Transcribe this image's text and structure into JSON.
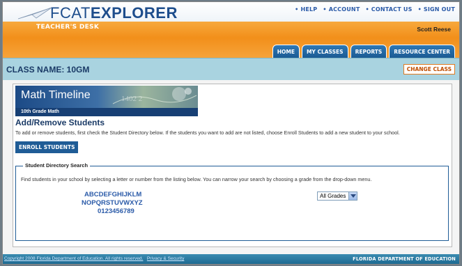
{
  "brand": {
    "logo_prefix": "FCAT",
    "logo_suffix": "EXPLORER"
  },
  "top_links": [
    "• HELP",
    "• ACCOUNT",
    "• CONTACT US",
    "• SIGN OUT"
  ],
  "header": {
    "section": "TEACHER'S DESK",
    "user_name": "Scott Reese"
  },
  "tabs": [
    "HOME",
    "MY CLASSES",
    "REPORTS",
    "RESOURCE CENTER"
  ],
  "classbar": {
    "class_name": "CLASS NAME: 10GM",
    "change_class": "CHANGE CLASS"
  },
  "banner": {
    "title": "Math Timeline",
    "subtitle": "10th Grade Math"
  },
  "main": {
    "heading": "Add/Remove Students",
    "intro": "To add or remove students, first check the Student Directory below. If the students you want to add are not listed, choose Enroll Students to add a new student to your school.",
    "enroll_button": "ENROLL STUDENTS"
  },
  "directory": {
    "legend": "Student Directory Search",
    "instructions": "Find students in your school by selecting a letter or number from the listing below. You can narrow your search by choosing a grade from the drop-down menu.",
    "row1": "ABCDEFGHIJKLM",
    "row2": "NOPQRSTUVWXYZ",
    "row3": "0123456789",
    "grade_selected": "All Grades"
  },
  "footer": {
    "copyright": "Copyright 2008 Florida Department of Education. All rights reserved.",
    "privacy": "Privacy & Security",
    "agency": "FLORIDA DEPARTMENT OF EDUCATION"
  },
  "colors": {
    "orange": "#f28f1a",
    "navy": "#1a3a66",
    "light_blue": "#a9d3e0",
    "button_blue": "#1f5c96"
  }
}
